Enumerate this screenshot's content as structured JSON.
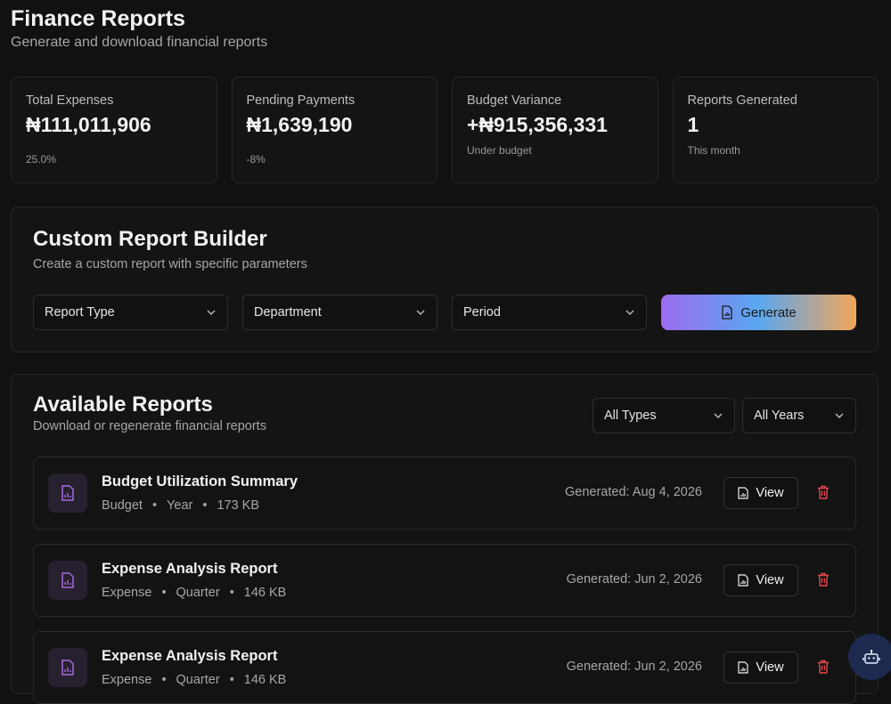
{
  "header": {
    "title": "Finance Reports",
    "subtitle": "Generate and download financial reports"
  },
  "stats": [
    {
      "label": "Total Expenses",
      "value": "₦111,011,906",
      "note": "25.0%"
    },
    {
      "label": "Pending Payments",
      "value": "₦1,639,190",
      "note": "-8%"
    },
    {
      "label": "Budget Variance",
      "value": "+₦915,356,331",
      "note": "Under budget"
    },
    {
      "label": "Reports Generated",
      "value": "1",
      "note": "This month"
    }
  ],
  "builder": {
    "title": "Custom Report Builder",
    "subtitle": "Create a custom report with specific parameters",
    "report_type": "Report Type",
    "department": "Department",
    "period": "Period",
    "generate_label": "Generate"
  },
  "reports": {
    "title": "Available Reports",
    "subtitle": "Download or regenerate financial reports",
    "type_filter": "All Types",
    "year_filter": "All Years",
    "view_label": "View",
    "items": [
      {
        "name": "Budget Utilization Summary",
        "type": "Budget",
        "period": "Year",
        "size": "173 KB",
        "generated": "Generated: Aug 4, 2026"
      },
      {
        "name": "Expense Analysis Report",
        "type": "Expense",
        "period": "Quarter",
        "size": "146 KB",
        "generated": "Generated: Jun 2, 2026"
      },
      {
        "name": "Expense Analysis Report",
        "type": "Expense",
        "period": "Quarter",
        "size": "146 KB",
        "generated": "Generated: Jun 2, 2026"
      }
    ]
  },
  "icons": {
    "file": "file-chart-icon",
    "trash": "trash-icon",
    "chevron": "chevron-down-icon",
    "assistant": "bot-icon"
  },
  "colors": {
    "background": "#111111",
    "accent_purple": "#9b6cf0",
    "danger": "#e5484d"
  }
}
